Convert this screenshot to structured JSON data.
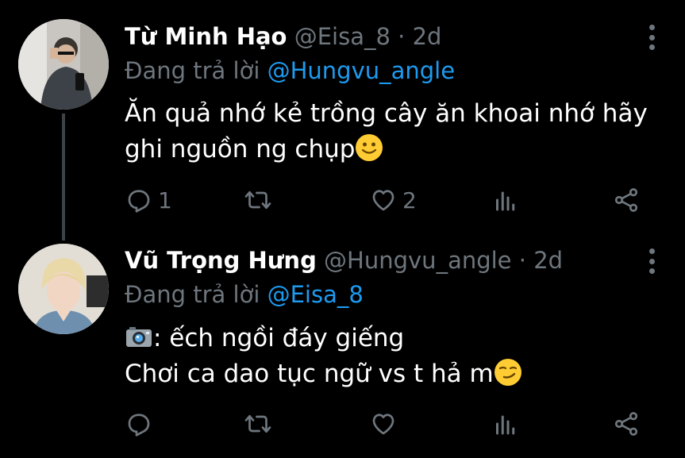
{
  "tweets": [
    {
      "name": "Từ Minh Hạo",
      "handle": "@Eisa_8",
      "separator": "·",
      "time": "2d",
      "reply_prefix": "Đang trả lời",
      "reply_to": "@Hungvu_angle",
      "line1": "Ăn quả nhớ kẻ trồng cây ăn khoai nhớ hãy",
      "line2": "ghi nguồn ng chụp",
      "emoji_end": "slightly-smiling-face",
      "reply_count": "1",
      "like_count": "2"
    },
    {
      "name": "Vũ Trọng Hưng",
      "handle": "@Hungvu_angle",
      "separator": "·",
      "time": "2d",
      "reply_prefix": "Đang trả lời",
      "reply_to": "@Eisa_8",
      "emoji_start": "camera",
      "line1": ": ếch ngồi đáy giếng",
      "line2": "Chơi ca dao tục ngữ vs t hả m",
      "emoji_end": "smirking-face",
      "reply_count": "",
      "like_count": ""
    }
  ],
  "colors": {
    "background": "#000000",
    "text": "#ffffff",
    "muted": "#6e767d",
    "mention": "#1d9bf0",
    "thread_line": "#3d4247"
  }
}
